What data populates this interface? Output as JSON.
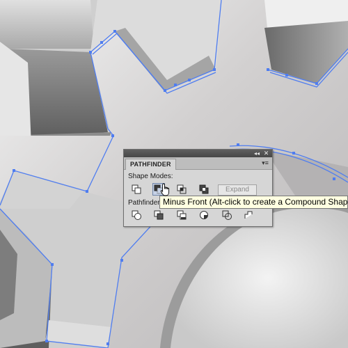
{
  "panel": {
    "tab_label": "PATHFINDER",
    "collapse_glyph": "◂◂",
    "close_glyph": "✕",
    "menu_glyph": "▾≡",
    "shape_modes_label": "Shape Modes:",
    "pathfinders_label": "Pathfinders:",
    "expand_label": "Expand",
    "expand_enabled": false,
    "shape_mode_buttons": [
      {
        "name": "unite",
        "icon": "unite-icon"
      },
      {
        "name": "minus-front",
        "icon": "minus-front-icon",
        "hovered": true
      },
      {
        "name": "intersect",
        "icon": "intersect-icon"
      },
      {
        "name": "exclude",
        "icon": "exclude-icon"
      }
    ],
    "pathfinder_buttons": [
      {
        "name": "divide",
        "icon": "divide-icon"
      },
      {
        "name": "trim",
        "icon": "trim-icon"
      },
      {
        "name": "merge",
        "icon": "merge-icon"
      },
      {
        "name": "crop",
        "icon": "crop-icon"
      },
      {
        "name": "outline",
        "icon": "outline-icon"
      },
      {
        "name": "minus-back",
        "icon": "minus-back-icon"
      }
    ]
  },
  "tooltip": {
    "text": "Minus Front (Alt-click to create a Compound Shape)"
  },
  "colors": {
    "selection_path": "#4f7df0",
    "panel_bg": "#d6d6d6",
    "titlebar": "#4f4f4f",
    "tooltip_bg": "#ffffe1",
    "hover_button": "#c6d2e6"
  },
  "cursor": {
    "icon": "hand-pointer-icon"
  }
}
